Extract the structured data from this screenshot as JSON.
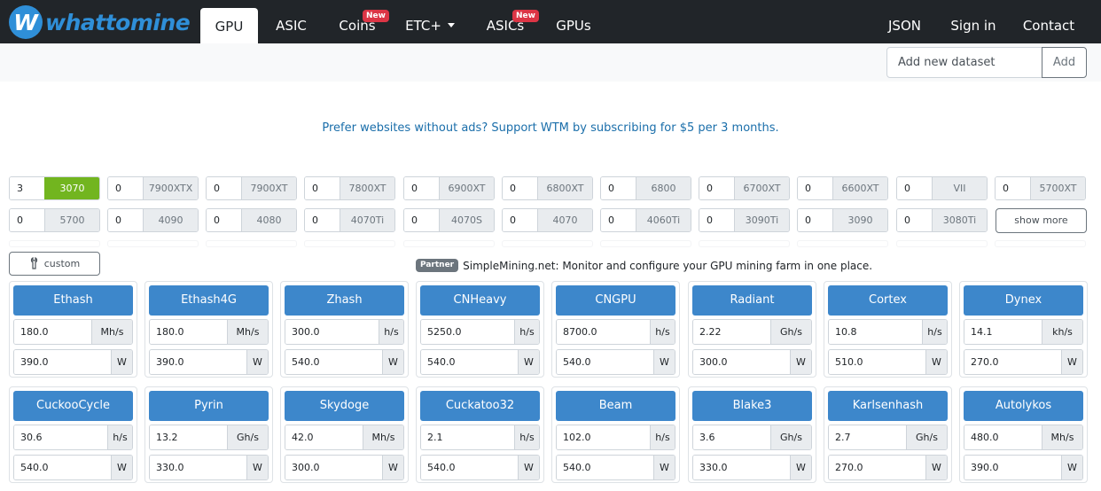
{
  "nav": {
    "logo_text": "whattomine",
    "logo_letter": "W",
    "items": [
      {
        "label": "GPU",
        "active": true
      },
      {
        "label": "ASIC"
      },
      {
        "label": "Coins",
        "badge": "New"
      },
      {
        "label": "ETC+"
      },
      {
        "label": "ASICs",
        "badge": "New"
      },
      {
        "label": "GPUs"
      }
    ],
    "right": [
      {
        "label": "JSON"
      },
      {
        "label": "Sign in"
      },
      {
        "label": "Contact"
      }
    ]
  },
  "dataset": {
    "placeholder": "Add new dataset",
    "add_label": "Add"
  },
  "promo_text": "Prefer websites without ads? Support WTM by subscribing for $5 per 3 months.",
  "gpus_row1": [
    {
      "qty": "3",
      "name": "3070",
      "selected": true
    },
    {
      "qty": "0",
      "name": "7900XTX"
    },
    {
      "qty": "0",
      "name": "7900XT"
    },
    {
      "qty": "0",
      "name": "7800XT"
    },
    {
      "qty": "0",
      "name": "6900XT"
    },
    {
      "qty": "0",
      "name": "6800XT"
    },
    {
      "qty": "0",
      "name": "6800"
    },
    {
      "qty": "0",
      "name": "6700XT"
    },
    {
      "qty": "0",
      "name": "6600XT"
    },
    {
      "qty": "0",
      "name": "VII"
    },
    {
      "qty": "0",
      "name": "5700XT"
    }
  ],
  "gpus_row2": [
    {
      "qty": "0",
      "name": "5700"
    },
    {
      "qty": "0",
      "name": "4090"
    },
    {
      "qty": "0",
      "name": "4080"
    },
    {
      "qty": "0",
      "name": "4070Ti"
    },
    {
      "qty": "0",
      "name": "4070S"
    },
    {
      "qty": "0",
      "name": "4070"
    },
    {
      "qty": "0",
      "name": "4060Ti"
    },
    {
      "qty": "0",
      "name": "3090Ti"
    },
    {
      "qty": "0",
      "name": "3090"
    },
    {
      "qty": "0",
      "name": "3080Ti"
    }
  ],
  "show_more_label": "show more",
  "custom_label": "custom",
  "partner": {
    "badge": "Partner",
    "text": "SimpleMining.net: Monitor and configure your GPU mining farm in one place."
  },
  "algos": [
    {
      "name": "Ethash",
      "hashrate": "180.0",
      "hr_unit": "Mh/s",
      "power": "390.0",
      "p_unit": "W"
    },
    {
      "name": "Ethash4G",
      "hashrate": "180.0",
      "hr_unit": "Mh/s",
      "power": "390.0",
      "p_unit": "W"
    },
    {
      "name": "Zhash",
      "hashrate": "300.0",
      "hr_unit": "h/s",
      "power": "540.0",
      "p_unit": "W"
    },
    {
      "name": "CNHeavy",
      "hashrate": "5250.0",
      "hr_unit": "h/s",
      "power": "540.0",
      "p_unit": "W"
    },
    {
      "name": "CNGPU",
      "hashrate": "8700.0",
      "hr_unit": "h/s",
      "power": "540.0",
      "p_unit": "W"
    },
    {
      "name": "Radiant",
      "hashrate": "2.22",
      "hr_unit": "Gh/s",
      "power": "300.0",
      "p_unit": "W"
    },
    {
      "name": "Cortex",
      "hashrate": "10.8",
      "hr_unit": "h/s",
      "power": "510.0",
      "p_unit": "W"
    },
    {
      "name": "Dynex",
      "hashrate": "14.1",
      "hr_unit": "kh/s",
      "power": "270.0",
      "p_unit": "W"
    },
    {
      "name": "CuckooCycle",
      "hashrate": "30.6",
      "hr_unit": "h/s",
      "power": "540.0",
      "p_unit": "W"
    },
    {
      "name": "Pyrin",
      "hashrate": "13.2",
      "hr_unit": "Gh/s",
      "power": "330.0",
      "p_unit": "W"
    },
    {
      "name": "Skydoge",
      "hashrate": "42.0",
      "hr_unit": "Mh/s",
      "power": "300.0",
      "p_unit": "W"
    },
    {
      "name": "Cuckatoo32",
      "hashrate": "2.1",
      "hr_unit": "h/s",
      "power": "540.0",
      "p_unit": "W"
    },
    {
      "name": "Beam",
      "hashrate": "102.0",
      "hr_unit": "h/s",
      "power": "540.0",
      "p_unit": "W"
    },
    {
      "name": "Blake3",
      "hashrate": "3.6",
      "hr_unit": "Gh/s",
      "power": "330.0",
      "p_unit": "W"
    },
    {
      "name": "Karlsenhash",
      "hashrate": "2.7",
      "hr_unit": "Gh/s",
      "power": "270.0",
      "p_unit": "W"
    },
    {
      "name": "Autolykos",
      "hashrate": "480.0",
      "hr_unit": "Mh/s",
      "power": "390.0",
      "p_unit": "W"
    }
  ]
}
